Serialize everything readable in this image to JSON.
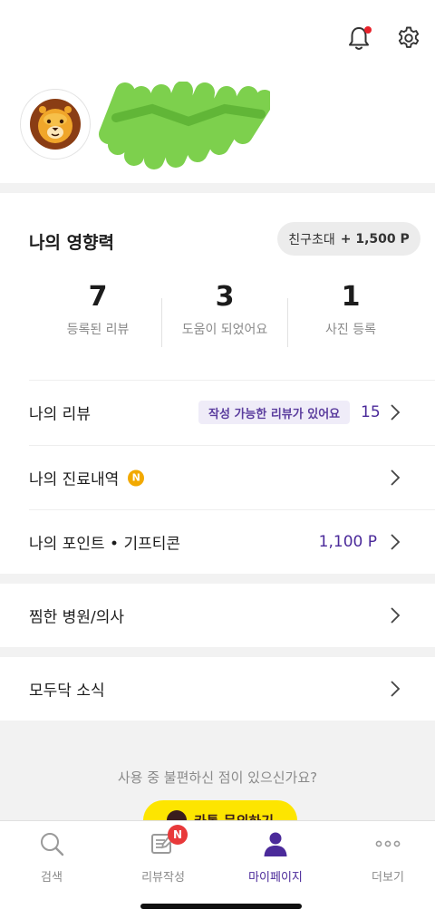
{
  "header": {
    "notification_icon": "bell-icon",
    "settings_icon": "gear-icon",
    "notification_dot_color": "#e8222b"
  },
  "profile": {
    "avatar_icon": "lion-icon"
  },
  "influence": {
    "title": "나의 영향력",
    "invite_label": "친구초대",
    "invite_amount": "+ 1,500 P",
    "stats": [
      {
        "value": "7",
        "label": "등록된 리뷰"
      },
      {
        "value": "3",
        "label": "도움이 되었어요"
      },
      {
        "value": "1",
        "label": "사진 등록"
      }
    ]
  },
  "menu": {
    "my_reviews": {
      "label": "나의 리뷰",
      "badge": "작성 가능한 리뷰가 있어요",
      "count": "15"
    },
    "my_treatments": {
      "label": "나의 진료내역",
      "new_badge": "N"
    },
    "my_points": {
      "label": "나의 포인트 • 기프티콘",
      "value": "1,100 P"
    },
    "favorites": {
      "label": "찜한 병원/의사"
    },
    "news": {
      "label": "모두닥 소식"
    }
  },
  "footer": {
    "question": "사용 중 불편하신 점이 있으신가요?",
    "kakao_button": "카톡 문의하기"
  },
  "tabbar": {
    "tabs": [
      {
        "label": "검색",
        "icon": "search-icon"
      },
      {
        "label": "리뷰작성",
        "icon": "write-review-icon",
        "badge": "N"
      },
      {
        "label": "마이페이지",
        "icon": "person-icon",
        "active": true
      },
      {
        "label": "더보기",
        "icon": "more-icon"
      }
    ]
  },
  "colors": {
    "accent": "#4b2a9a",
    "badge_bg": "#efecf8",
    "kakao_yellow": "#fde500"
  }
}
